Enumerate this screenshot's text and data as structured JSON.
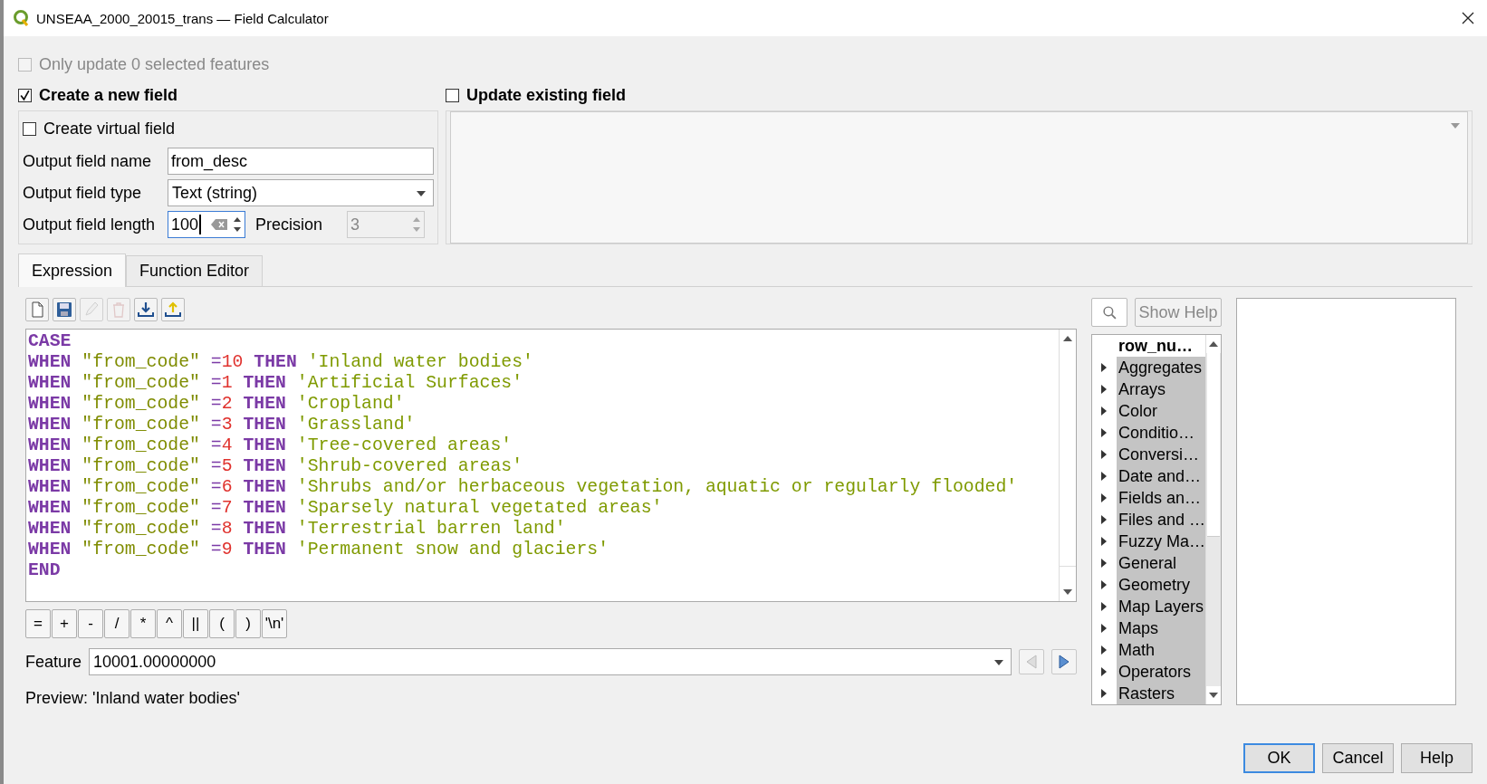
{
  "window": {
    "title": "UNSEAA_2000_20015_trans — Field Calculator"
  },
  "only_update": {
    "label": "Only update 0 selected features",
    "checked": false,
    "disabled": true
  },
  "create_new": {
    "label": "Create a new field",
    "checked": true
  },
  "update_existing": {
    "label": "Update existing field",
    "checked": false
  },
  "virtual_field": {
    "label": "Create virtual field",
    "checked": false
  },
  "output_name": {
    "label": "Output field name",
    "value": "from_desc"
  },
  "output_type": {
    "label": "Output field type",
    "value": "Text (string)"
  },
  "output_length": {
    "label": "Output field length",
    "value": "100"
  },
  "precision": {
    "label": "Precision",
    "value": "3",
    "disabled": true
  },
  "tabs": [
    {
      "label": "Expression",
      "selected": true
    },
    {
      "label": "Function Editor",
      "selected": false
    }
  ],
  "toolbar": [
    {
      "kind": "new",
      "disabled": false
    },
    {
      "kind": "save",
      "disabled": false
    },
    {
      "kind": "edit",
      "disabled": true
    },
    {
      "kind": "delete",
      "disabled": true
    },
    {
      "kind": "import",
      "disabled": false
    },
    {
      "kind": "export",
      "disabled": false
    }
  ],
  "code_lines": [
    [
      {
        "kind": "keyword",
        "text": "CASE"
      }
    ],
    [
      {
        "kind": "keyword",
        "text": "WHEN"
      },
      {
        "kind": "field",
        "text": "\"from_code\""
      },
      {
        "kind": "comparison",
        "operator": "=",
        "value": "10"
      },
      {
        "kind": "keyword",
        "text": "THEN"
      },
      {
        "kind": "string",
        "text": "'Inland water bodies'"
      }
    ],
    [
      {
        "kind": "keyword",
        "text": "WHEN"
      },
      {
        "kind": "field",
        "text": "\"from_code\""
      },
      {
        "kind": "comparison",
        "operator": "=",
        "value": "1"
      },
      {
        "kind": "keyword",
        "text": "THEN"
      },
      {
        "kind": "string",
        "text": "'Artificial Surfaces'"
      }
    ],
    [
      {
        "kind": "keyword",
        "text": "WHEN"
      },
      {
        "kind": "field",
        "text": "\"from_code\""
      },
      {
        "kind": "comparison",
        "operator": "=",
        "value": "2"
      },
      {
        "kind": "keyword",
        "text": "THEN"
      },
      {
        "kind": "string",
        "text": "'Cropland'"
      }
    ],
    [
      {
        "kind": "keyword",
        "text": "WHEN"
      },
      {
        "kind": "field",
        "text": "\"from_code\""
      },
      {
        "kind": "comparison",
        "operator": "=",
        "value": "3"
      },
      {
        "kind": "keyword",
        "text": "THEN"
      },
      {
        "kind": "string",
        "text": "'Grassland'"
      }
    ],
    [
      {
        "kind": "keyword",
        "text": "WHEN"
      },
      {
        "kind": "field",
        "text": "\"from_code\""
      },
      {
        "kind": "comparison",
        "operator": "=",
        "value": "4"
      },
      {
        "kind": "keyword",
        "text": "THEN"
      },
      {
        "kind": "string",
        "text": "'Tree-covered areas'"
      }
    ],
    [
      {
        "kind": "keyword",
        "text": "WHEN"
      },
      {
        "kind": "field",
        "text": "\"from_code\""
      },
      {
        "kind": "comparison",
        "operator": "=",
        "value": "5"
      },
      {
        "kind": "keyword",
        "text": "THEN"
      },
      {
        "kind": "string",
        "text": "'Shrub-covered areas'"
      }
    ],
    [
      {
        "kind": "keyword",
        "text": "WHEN"
      },
      {
        "kind": "field",
        "text": "\"from_code\""
      },
      {
        "kind": "comparison",
        "operator": "=",
        "value": "6"
      },
      {
        "kind": "keyword",
        "text": "THEN"
      },
      {
        "kind": "string",
        "text": "'Shrubs and/or herbaceous vegetation, aquatic or regularly flooded'"
      }
    ],
    [
      {
        "kind": "keyword",
        "text": "WHEN"
      },
      {
        "kind": "field",
        "text": "\"from_code\""
      },
      {
        "kind": "comparison",
        "operator": "=",
        "value": "7"
      },
      {
        "kind": "keyword",
        "text": "THEN"
      },
      {
        "kind": "string",
        "text": "'Sparsely natural vegetated areas'"
      }
    ],
    [
      {
        "kind": "keyword",
        "text": "WHEN"
      },
      {
        "kind": "field",
        "text": "\"from_code\""
      },
      {
        "kind": "comparison",
        "operator": "=",
        "value": "8"
      },
      {
        "kind": "keyword",
        "text": "THEN"
      },
      {
        "kind": "string",
        "text": "'Terrestrial barren land'"
      }
    ],
    [
      {
        "kind": "keyword",
        "text": "WHEN"
      },
      {
        "kind": "field",
        "text": "\"from_code\""
      },
      {
        "kind": "comparison",
        "operator": "=",
        "value": "9"
      },
      {
        "kind": "keyword",
        "text": "THEN"
      },
      {
        "kind": "string",
        "text": "'Permanent snow and glaciers'"
      }
    ],
    [
      {
        "kind": "keyword",
        "text": "END"
      }
    ]
  ],
  "operators": [
    "=",
    "+",
    "-",
    "/",
    "*",
    "^",
    "||",
    "(",
    ")",
    "'\\n'"
  ],
  "feature": {
    "label": "Feature",
    "value": "10001.00000000"
  },
  "feature_nav": [
    {
      "kind": "previous",
      "disabled": true
    },
    {
      "kind": "next",
      "disabled": false
    }
  ],
  "preview": "Preview: 'Inland water bodies'",
  "show_help": "Show Help",
  "function_tree": [
    {
      "kind": "function",
      "label": "row_nu…"
    },
    {
      "kind": "group",
      "label": "Aggregates",
      "expanded": false
    },
    {
      "kind": "group",
      "label": "Arrays",
      "expanded": false
    },
    {
      "kind": "group",
      "label": "Color",
      "expanded": false
    },
    {
      "kind": "group",
      "label": "Conditio…",
      "expanded": false
    },
    {
      "kind": "group",
      "label": "Conversi…",
      "expanded": false
    },
    {
      "kind": "group",
      "label": "Date and…",
      "expanded": false
    },
    {
      "kind": "group",
      "label": "Fields an…",
      "expanded": false
    },
    {
      "kind": "group",
      "label": "Files and …",
      "expanded": false
    },
    {
      "kind": "group",
      "label": "Fuzzy Ma…",
      "expanded": false
    },
    {
      "kind": "group",
      "label": "General",
      "expanded": false
    },
    {
      "kind": "group",
      "label": "Geometry",
      "expanded": false
    },
    {
      "kind": "group",
      "label": "Map Layers",
      "expanded": false
    },
    {
      "kind": "group",
      "label": "Maps",
      "expanded": false
    },
    {
      "kind": "group",
      "label": "Math",
      "expanded": false
    },
    {
      "kind": "group",
      "label": "Operators",
      "expanded": false
    },
    {
      "kind": "group",
      "label": "Rasters",
      "expanded": false
    }
  ],
  "buttons": [
    {
      "label": "OK",
      "default": true
    },
    {
      "label": "Cancel",
      "default": false
    },
    {
      "label": "Help",
      "default": false
    }
  ]
}
